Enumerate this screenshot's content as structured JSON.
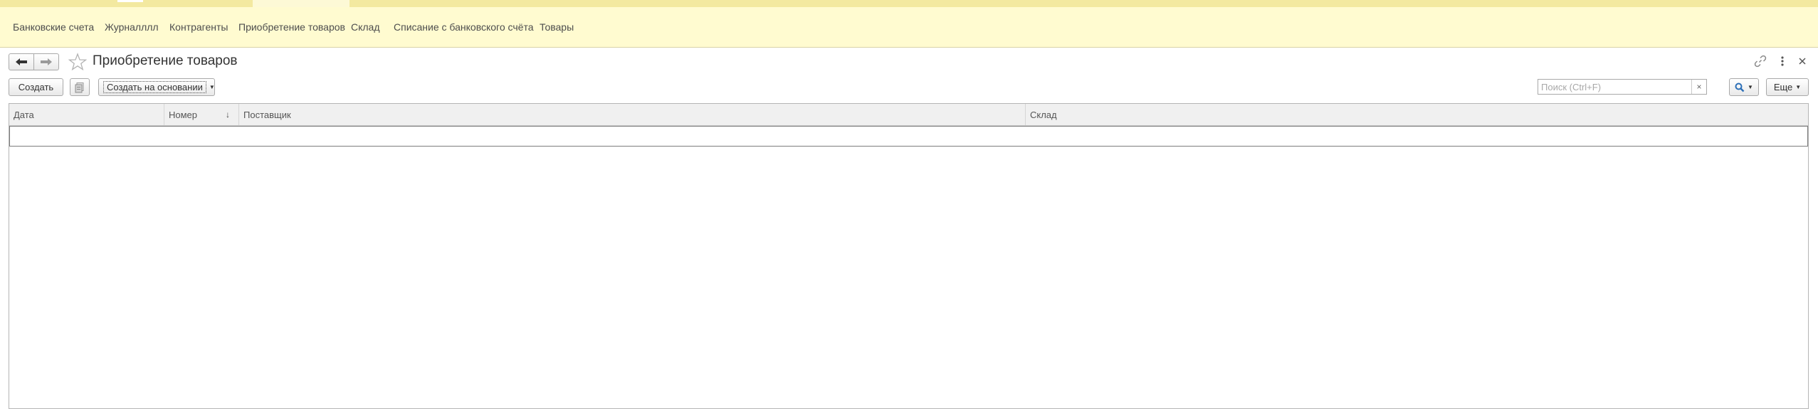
{
  "sections": [
    {
      "label": "Банковские счета"
    },
    {
      "label": "Журналллл"
    },
    {
      "label": "Контрагенты"
    },
    {
      "label": "Приобретение товаров"
    },
    {
      "label": "Склад"
    },
    {
      "label": "Списание с банковского счёта"
    },
    {
      "label": "Товары"
    }
  ],
  "header": {
    "title": "Приобретение товаров",
    "icons": [
      "back-arrow-icon",
      "forward-arrow-icon",
      "star-icon",
      "link-icon",
      "more-vertical-icon",
      "close-icon"
    ]
  },
  "toolbar": {
    "create_label": "Создать",
    "based_on_label": "Создать на основании",
    "search_placeholder": "Поиск (Ctrl+F)",
    "search_value": "",
    "clear_label": "×",
    "more_label": "Еще"
  },
  "table": {
    "columns": [
      {
        "label": "Дата"
      },
      {
        "label": "Номер",
        "sort": "↓"
      },
      {
        "label": "Поставщик"
      },
      {
        "label": "Склад"
      }
    ],
    "rows": []
  },
  "colors": {
    "section_panel_bg": "#fffbd0",
    "top_strip_bg": "#f3e9a0",
    "header_bg": "#f0f0f0"
  }
}
